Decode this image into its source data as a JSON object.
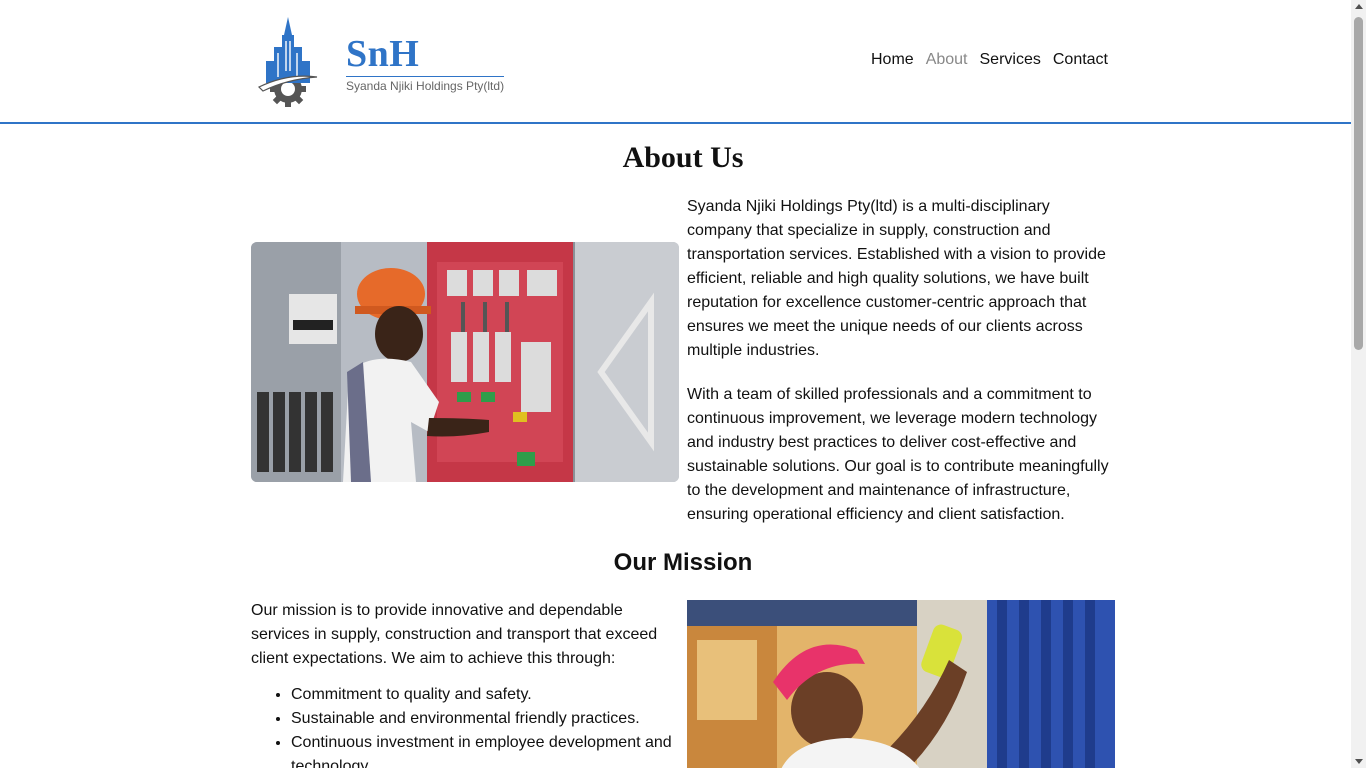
{
  "header": {
    "brand_title": "SnH",
    "brand_subtitle": "Syanda Njiki Holdings Pty(ltd)",
    "nav": [
      {
        "label": "Home"
      },
      {
        "label": "About"
      },
      {
        "label": "Services"
      },
      {
        "label": "Contact"
      }
    ],
    "active_nav": "About"
  },
  "about": {
    "heading": "About Us",
    "paragraphs": [
      "Syanda Njiki Holdings Pty(ltd) is a multi-disciplinary company that specialize in supply, construction and transportation services. Established with a vision to provide efficient, reliable and high quality solutions, we have built reputation for excellence customer-centric approach that ensures we meet the unique needs of our clients across multiple industries.",
      "With a team of skilled professionals and a commitment to continuous improvement, we leverage modern technology and industry best practices to deliver cost-effective and sustainable solutions. Our goal is to contribute meaningfully to the development and maintenance of infrastructure, ensuring operational efficiency and client satisfaction."
    ]
  },
  "mission": {
    "heading": "Our Mission",
    "intro": "Our mission is to provide innovative and dependable services in supply, construction and transport that exceed client expectations. We aim to achieve this through:",
    "items": [
      "Commitment to quality and safety.",
      "Sustainable and environmental friendly practices.",
      "Continuous investment in employee development and technology."
    ]
  },
  "colors": {
    "brand_blue": "#2f74c7",
    "nav_active": "#888888"
  }
}
